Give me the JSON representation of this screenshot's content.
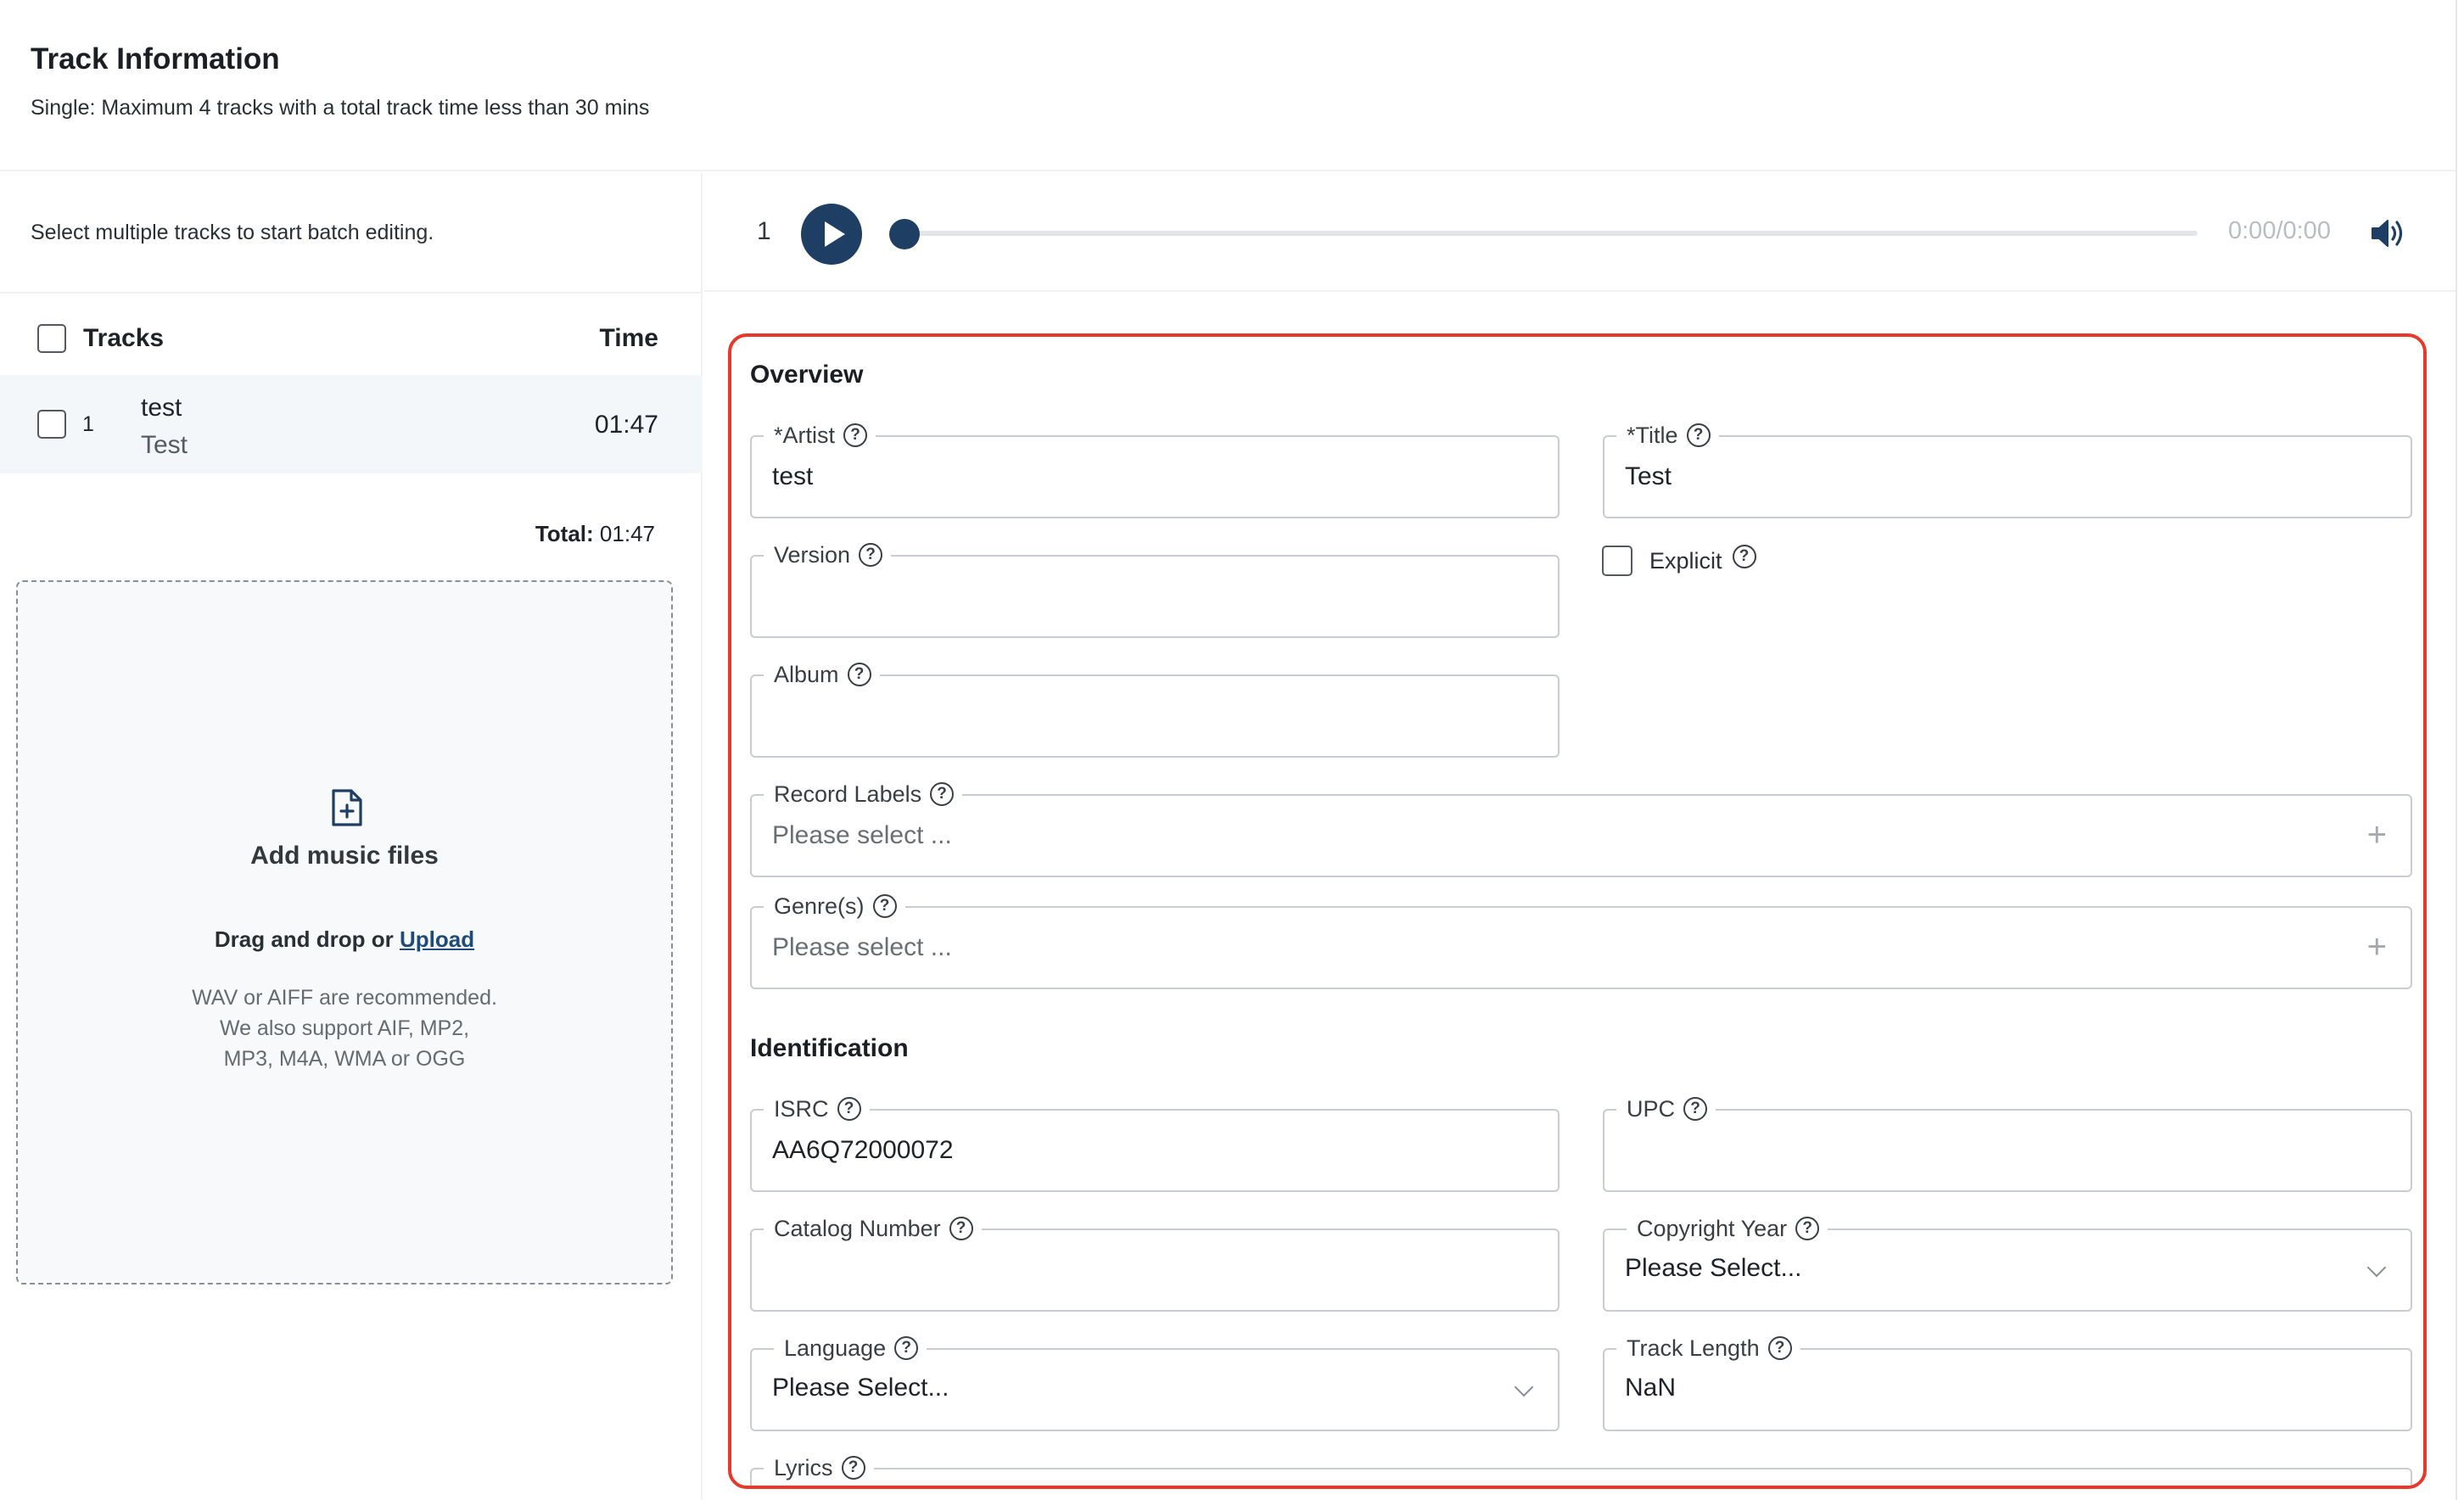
{
  "header": {
    "title": "Track Information",
    "subtitle": "Single: Maximum 4 tracks with a total track time less than 30 mins"
  },
  "left_panel": {
    "batch_hint": "Select multiple tracks to start batch editing.",
    "columns": {
      "tracks": "Tracks",
      "time": "Time"
    },
    "tracks": [
      {
        "number": "1",
        "name": "test",
        "artist": "Test",
        "duration": "01:47"
      }
    ],
    "total_label": "Total:",
    "total_value": "01:47",
    "dropzone": {
      "title": "Add music files",
      "drag_text": "Drag and drop or",
      "upload_link": "Upload",
      "formats_line1": "WAV or AIFF are recommended.",
      "formats_line2": "We also support AIF, MP2,",
      "formats_line3": "MP3, M4A, WMA or OGG"
    }
  },
  "player": {
    "track_number": "1",
    "timecode": "0:00/0:00",
    "progress": 0
  },
  "form": {
    "overview": {
      "title": "Overview",
      "artist_label": "*Artist",
      "artist_value": "test",
      "title_label": "*Title",
      "title_value": "Test",
      "version_label": "Version",
      "version_value": "",
      "explicit_label": "Explicit",
      "explicit_checked": false,
      "album_label": "Album",
      "album_value": "",
      "record_labels_label": "Record Labels",
      "record_labels_placeholder": "Please select ...",
      "genres_label": "Genre(s)",
      "genres_placeholder": "Please select ..."
    },
    "identification": {
      "title": "Identification",
      "isrc_label": "ISRC",
      "isrc_value": "AA6Q72000072",
      "upc_label": "UPC",
      "upc_value": "",
      "catalog_label": "Catalog Number",
      "catalog_value": "",
      "copyright_year_label": "Copyright Year",
      "copyright_year_value": "Please Select...",
      "language_label": "Language",
      "language_value": "Please Select...",
      "track_length_label": "Track Length",
      "track_length_value": "NaN",
      "lyrics_label": "Lyrics"
    },
    "help_glyph": "?",
    "plus_glyph": "+"
  },
  "colors": {
    "accent": "#1e3f63",
    "highlight_border": "#e8372b",
    "row_bg": "#f4f7fa"
  },
  "icons": [
    "file-add-icon",
    "play-icon",
    "volume-icon",
    "help-icon",
    "plus-icon",
    "chevron-down-icon"
  ]
}
